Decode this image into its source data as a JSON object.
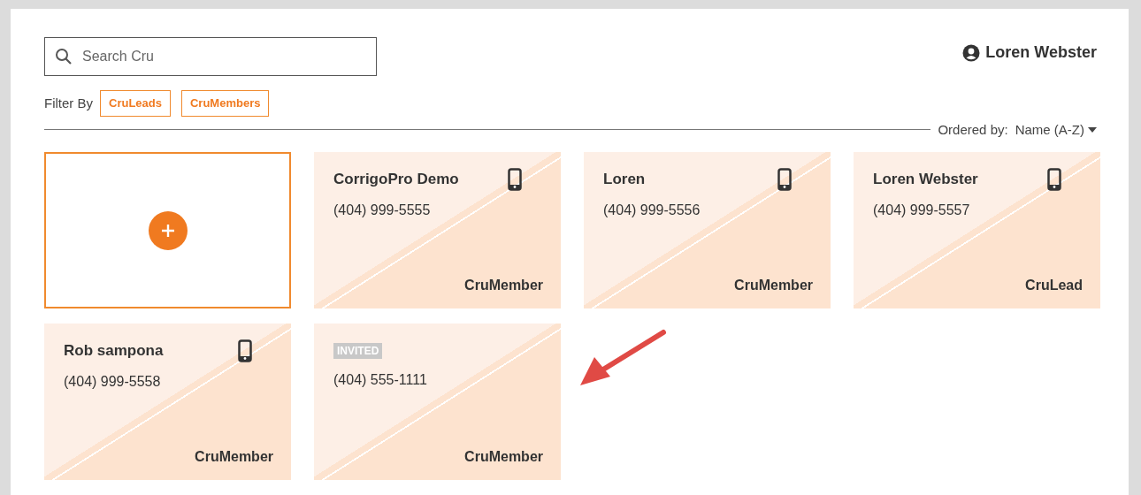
{
  "search": {
    "placeholder": "Search Cru"
  },
  "user": {
    "name": "Loren Webster"
  },
  "filter": {
    "label": "Filter By",
    "options": [
      {
        "label": "CruLeads",
        "selected": false
      },
      {
        "label": "CruMembers",
        "selected": false
      }
    ]
  },
  "order": {
    "label": "Ordered by:",
    "value": "Name (A-Z)"
  },
  "cards": [
    {
      "kind": "add"
    },
    {
      "kind": "contact",
      "name": "CorrigoPro Demo",
      "phone": "(404) 999-5555",
      "role": "CruMember",
      "mobile": true
    },
    {
      "kind": "contact",
      "name": "Loren",
      "phone": "(404) 999-5556",
      "role": "CruMember",
      "mobile": true
    },
    {
      "kind": "contact",
      "name": "Loren Webster",
      "phone": "(404) 999-5557",
      "role": "CruLead",
      "mobile": true
    },
    {
      "kind": "contact",
      "name": "Rob sampona",
      "phone": "(404) 999-5558",
      "role": "CruMember",
      "mobile": true
    },
    {
      "kind": "contact",
      "badge": "INVITED",
      "phone": "(404) 555-1111",
      "role": "CruMember",
      "mobile": false
    }
  ]
}
